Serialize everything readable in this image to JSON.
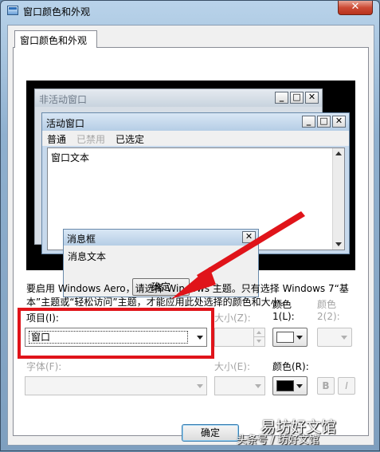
{
  "window": {
    "title": "窗口颜色和外观",
    "close_glyph": "✕"
  },
  "tab": {
    "label": "窗口颜色和外观"
  },
  "preview": {
    "inactive_title": "非活动窗口",
    "active_title": "活动窗口",
    "menu": [
      "普通",
      "已禁用",
      "已选定"
    ],
    "window_text": "窗口文本",
    "msgbox_title": "消息框",
    "msgbox_text": "消息文本",
    "msgbox_ok": "确定",
    "min_glyph": "_",
    "max_glyph": "□",
    "close_glyph": "✕"
  },
  "description": "要启用 Windows Aero，请选择 Windows 主题。只有选择 Windows 7“基本”主题或“轻松访问”主题，才能应用此处选择的颜色和大小。",
  "item": {
    "label": "项目(I):",
    "value": "窗口"
  },
  "size1_label": "大小(Z):",
  "color1_label": "颜色",
  "color1_sub": "1(L):",
  "color2_label": "颜色",
  "color2_sub": "2(2):",
  "font_label": "字体(F):",
  "size2_label": "大小(E):",
  "font_color_label": "颜色(R):",
  "bold": "B",
  "italic": "I",
  "ok_button": "确定",
  "watermark": {
    "top": "易坊好文馆",
    "bottom": "头条号 / 坊好文馆"
  },
  "colors": {
    "color1_swatch": "#ffffff",
    "font_color_swatch": "#000000",
    "highlight": "#e0141a"
  }
}
